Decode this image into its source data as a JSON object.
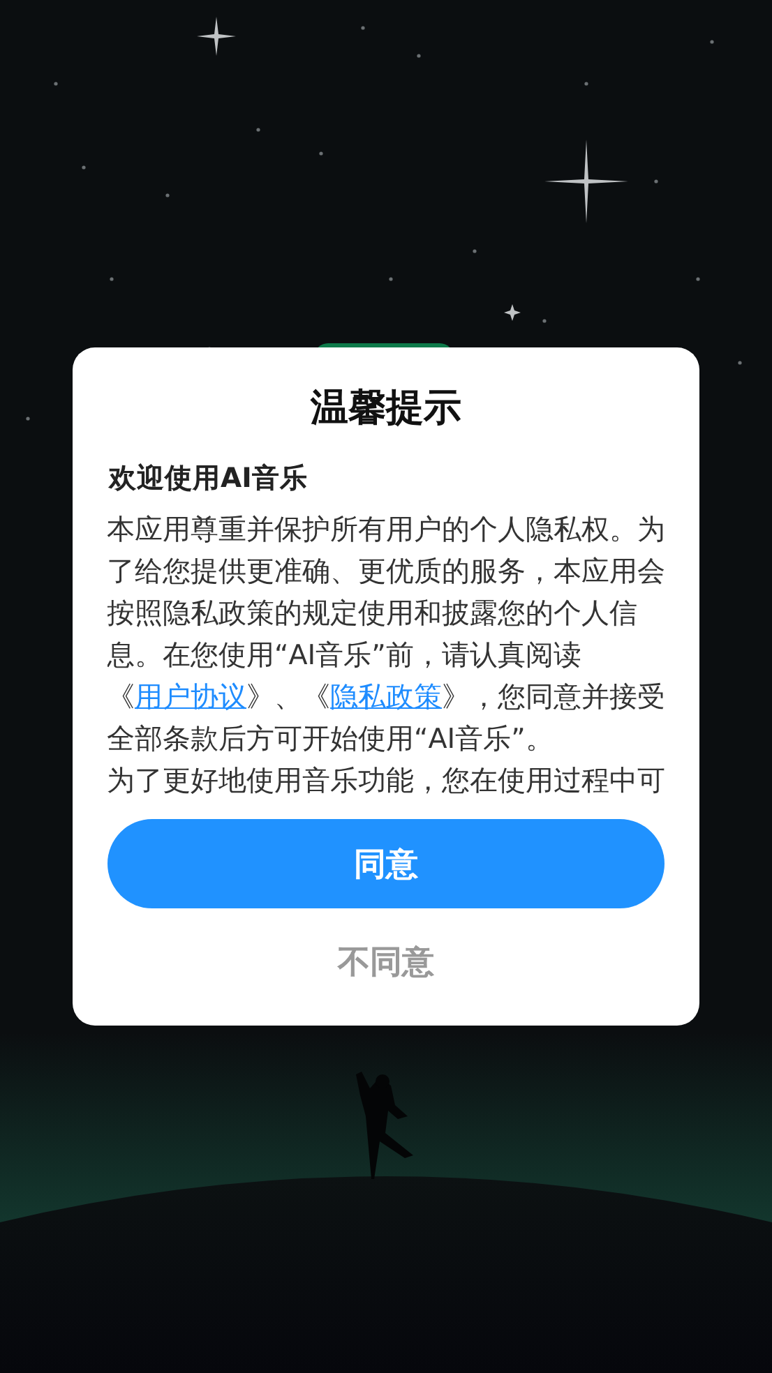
{
  "dialog": {
    "title": "温馨提示",
    "heading": "欢迎使用AI音乐",
    "paragraphs": [
      {
        "segments": [
          {
            "kind": "text",
            "text": "本应用尊重并保护所有用户的个人隐私权。为了给您提供更准确、更优质的服务，本应用会按照隐私政策的规定使用和披露您的个人信息。在您使用“AI音乐”前，请认真阅读《"
          },
          {
            "kind": "link",
            "text": "用户协议"
          },
          {
            "kind": "text",
            "text": "》、《"
          },
          {
            "kind": "link",
            "text": "隐私政策"
          },
          {
            "kind": "text",
            "text": "》，您同意并接受全部条款后方可开始使用“AI音乐”。"
          }
        ]
      },
      {
        "segments": [
          {
            "kind": "text",
            "text": "为了更好地使用音乐功能，您在使用过程中可"
          }
        ]
      }
    ],
    "buttons": [
      {
        "kind": "primary",
        "label": "同意"
      },
      {
        "kind": "secondary",
        "label": "不同意"
      }
    ]
  }
}
